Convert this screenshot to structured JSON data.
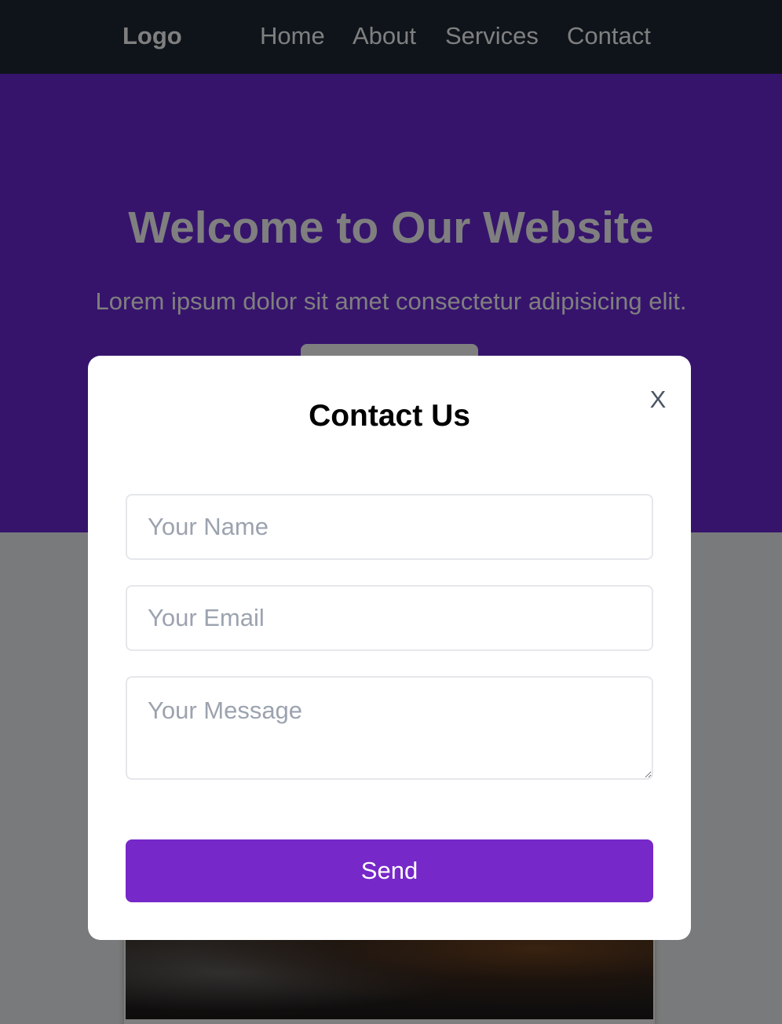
{
  "nav": {
    "logo": "Logo",
    "links": [
      "Home",
      "About",
      "Services",
      "Contact"
    ]
  },
  "hero": {
    "title": "Welcome to Our Website",
    "subtitle": "Lorem ipsum dolor sit amet consectetur adipisicing elit."
  },
  "modal": {
    "close_label": "X",
    "title": "Contact Us",
    "name_placeholder": "Your Name",
    "email_placeholder": "Your Email",
    "message_placeholder": "Your Message",
    "send_label": "Send"
  },
  "colors": {
    "navbar": "#1f2937",
    "hero": "#6d28d9",
    "accent": "#7628c8",
    "overlay": "rgba(0,0,0,0.5)"
  }
}
